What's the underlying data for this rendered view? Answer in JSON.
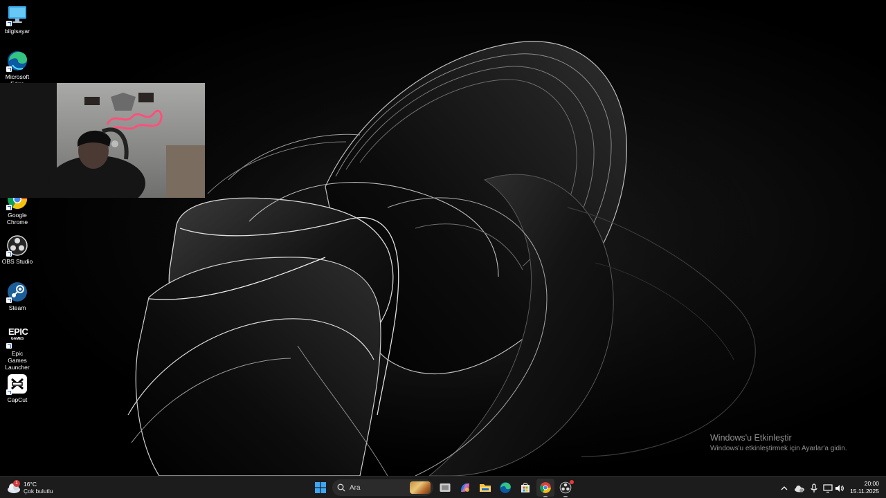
{
  "desktop": {
    "icons": [
      {
        "label": "bilgisayar",
        "icon": "monitor-icon"
      },
      {
        "label": "Microsoft Edge",
        "icon": "edge-icon"
      },
      {
        "label": "Google Chrome",
        "icon": "chrome-icon"
      },
      {
        "label": "OBS Studio",
        "icon": "obs-icon"
      },
      {
        "label": "Steam",
        "icon": "steam-icon"
      },
      {
        "label": "Epic Games Launcher",
        "icon": "epic-games-icon"
      },
      {
        "label": "CapCut",
        "icon": "capcut-icon"
      }
    ],
    "epic_logo_text": "EPIC",
    "epic_logo_sub": "GAMES"
  },
  "activation": {
    "title": "Windows'u Etkinleştir",
    "subtitle": "Windows'u etkinleştirmek için Ayarlar'a gidin."
  },
  "taskbar": {
    "weather": {
      "temp": "16°C",
      "condition": "Çok bulutlu",
      "badge": "1"
    },
    "search": {
      "placeholder": "Ara"
    },
    "apps": [
      {
        "name": "start",
        "icon": "windows-logo-icon"
      },
      {
        "name": "task-view",
        "icon": "task-view-icon"
      },
      {
        "name": "copilot",
        "icon": "copilot-icon"
      },
      {
        "name": "file-explorer",
        "icon": "folder-icon"
      },
      {
        "name": "edge",
        "icon": "edge-icon"
      },
      {
        "name": "store",
        "icon": "store-icon"
      },
      {
        "name": "chrome",
        "icon": "chrome-icon",
        "active": true
      },
      {
        "name": "obs",
        "icon": "obs-icon",
        "running": true
      }
    ],
    "tray": {
      "icons": [
        "chevron-up-icon",
        "onedrive-icon",
        "microphone-icon",
        "display-icon",
        "volume-icon"
      ]
    },
    "clock": {
      "time": "20:00",
      "date": "15.11.2025"
    }
  },
  "colors": {
    "taskbar_bg": "#1c1c1c",
    "accent_blue": "#0078d4",
    "search_bg": "#2b2b2b"
  }
}
